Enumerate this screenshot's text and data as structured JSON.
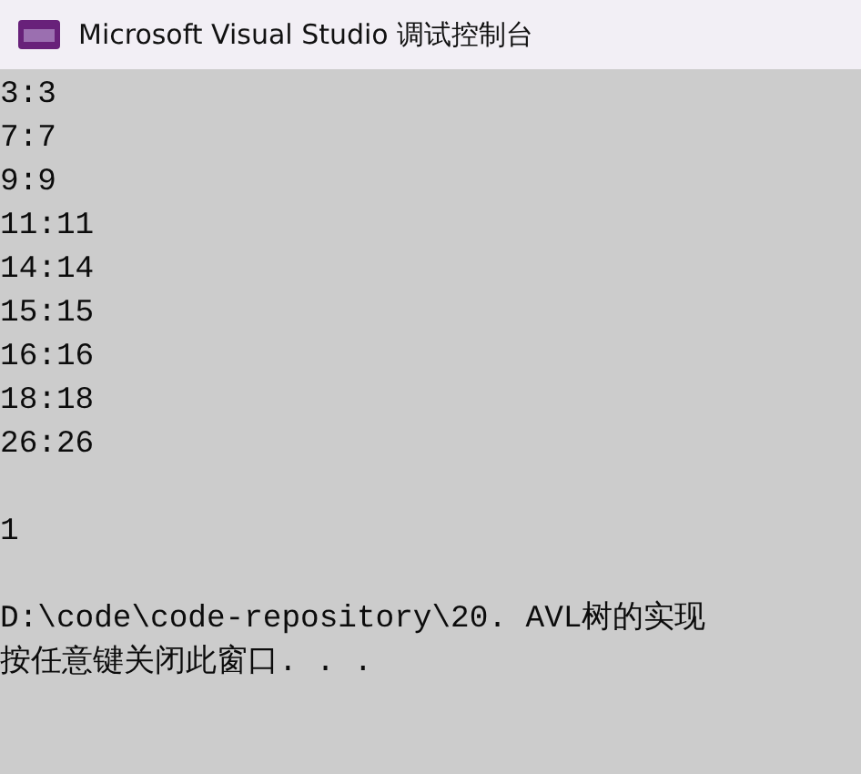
{
  "window": {
    "title": "Microsoft Visual Studio 调试控制台"
  },
  "console": {
    "blocks": [
      {
        "lines": [
          "3:3",
          "7:7",
          "9:9",
          "11:11",
          "14:14",
          "15:15",
          "16:16",
          "18:18",
          "26:26"
        ]
      },
      {
        "lines": [
          "1"
        ]
      },
      {
        "lines": [
          "D:\\code\\code-repository\\20. AVL树的实现",
          "按任意键关闭此窗口. . ."
        ]
      }
    ]
  }
}
